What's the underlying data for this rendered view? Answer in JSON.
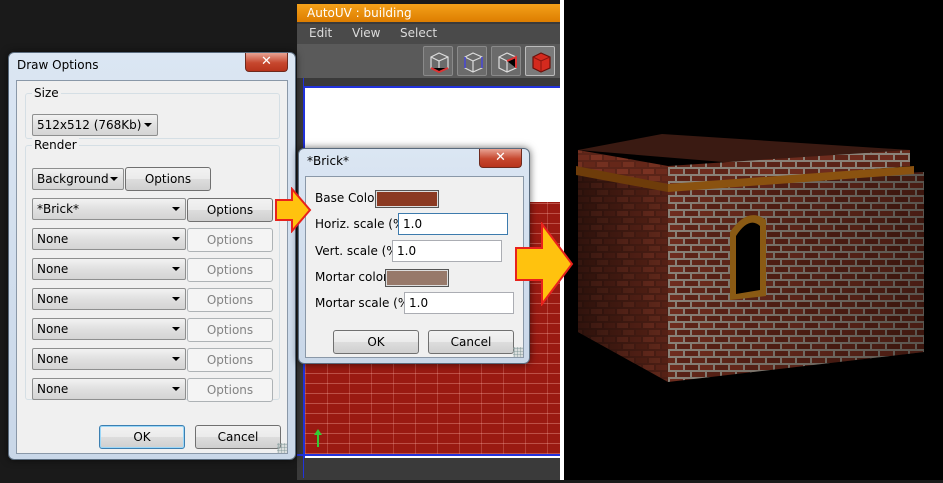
{
  "autouv": {
    "title": "AutoUV : building",
    "menu": [
      "Edit",
      "View",
      "Select"
    ],
    "toolbar_icons": [
      "wireframe-cube-icon",
      "vertex-cube-icon",
      "edge-cube-icon",
      "face-cube-icon"
    ]
  },
  "draw_options": {
    "title": "Draw Options",
    "close_label": "✕",
    "size_group": "Size",
    "size_value": "512x512 (768Kb)",
    "render_group": "Render",
    "background_value": "Background",
    "background_options_label": "Options",
    "layers": [
      {
        "value": "*Brick*",
        "options_label": "Options",
        "enabled": true
      },
      {
        "value": "None",
        "options_label": "Options",
        "enabled": false
      },
      {
        "value": "None",
        "options_label": "Options",
        "enabled": false
      },
      {
        "value": "None",
        "options_label": "Options",
        "enabled": false
      },
      {
        "value": "None",
        "options_label": "Options",
        "enabled": false
      },
      {
        "value": "None",
        "options_label": "Options",
        "enabled": false
      },
      {
        "value": "None",
        "options_label": "Options",
        "enabled": false
      }
    ],
    "ok_label": "OK",
    "cancel_label": "Cancel"
  },
  "brick_dialog": {
    "title": "*Brick*",
    "close_label": "✕",
    "base_color_label": "Base Color",
    "base_color": "#8b3a22",
    "horiz_label": "Horiz. scale (%)",
    "horiz_value": "1.0",
    "vert_label": "Vert. scale (%)",
    "vert_value": "1.0",
    "mortar_color_label": "Mortar color",
    "mortar_color": "#97796a",
    "mortar_scale_label": "Mortar scale (%)",
    "mortar_scale_value": "1.0",
    "ok_label": "OK",
    "cancel_label": "Cancel"
  },
  "colors": {
    "arrow": "#ffc20e",
    "arrow_outline": "#e8221c",
    "autouv_title": "#f4a11a",
    "uv_border": "#2233dd"
  }
}
